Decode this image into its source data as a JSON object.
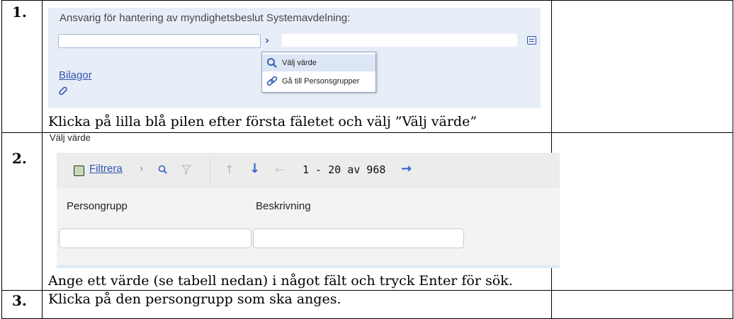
{
  "steps": [
    {
      "number": "1.",
      "field_label": "Ansvarig för hantering av myndighetsbeslut Systemavdelning:",
      "menu": [
        "Välj värde",
        "Gå till Personsgrupper"
      ],
      "link": "Bilagor",
      "instruction": "Klicka på lilla blå pilen efter första fäletet och välj ”Välj värde”"
    },
    {
      "number": "2.",
      "dialog_title": "Välj värde",
      "filter_link": "Filtrera",
      "paging": "1 - 20 av 968",
      "columns": [
        "Persongrupp",
        "Beskrivning"
      ],
      "instruction": "Ange ett värde (se tabell nedan) i något fält och tryck Enter för sök."
    },
    {
      "number": "3.",
      "instruction": "Klicka på den persongrupp som ska anges."
    }
  ],
  "colors": {
    "link_blue": "#2f55b0",
    "arrow_blue": "#3563c6",
    "panel_bg": "#e8eef8"
  }
}
